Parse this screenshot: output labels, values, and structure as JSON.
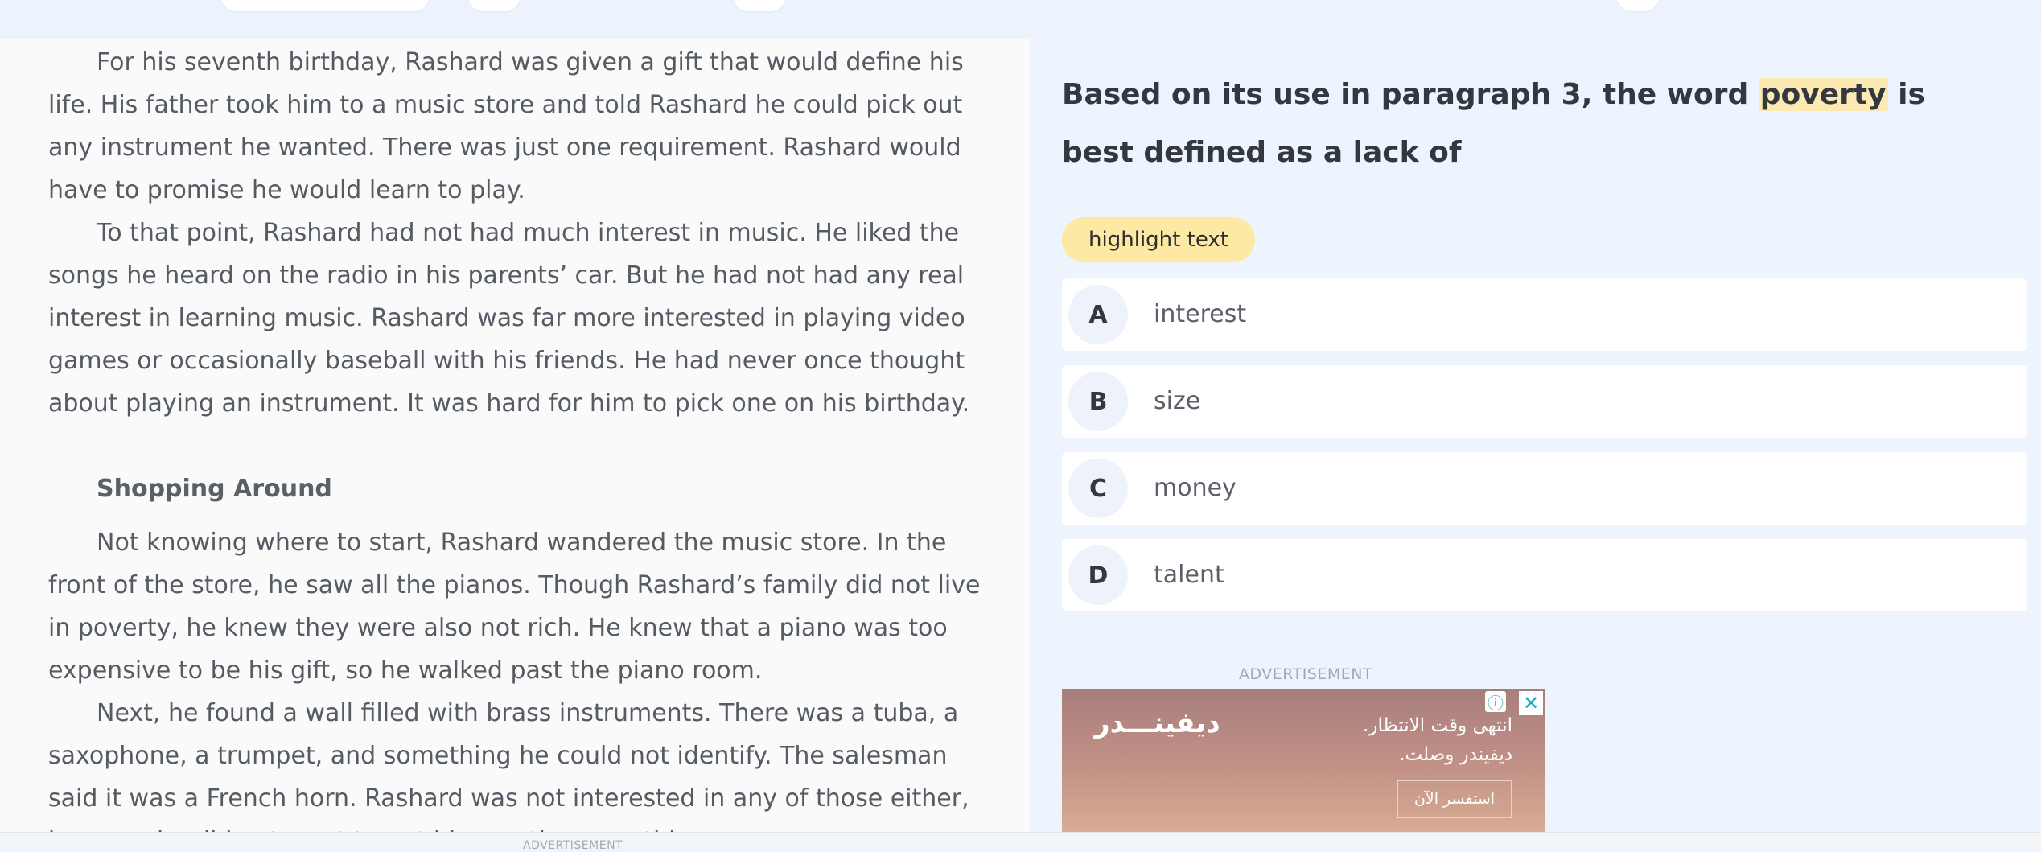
{
  "passage": {
    "paragraphs": {
      "p1": "For his seventh birthday, Rashard was given a gift that would define his life. His father took him to a music store and told Rashard he could pick out any instrument he wanted. There was just one requirement. Rashard would have to promise he would learn to play.",
      "p2": "To that point, Rashard had not had much interest in music. He liked the songs he heard on the radio in his parents’ car. But he had not had any real interest in learning music. Rashard was far more interested in playing video games or occasionally baseball with his friends. He had never once thought about playing an instrument. It was hard for him to pick one on his birthday.",
      "heading": "Shopping Around",
      "p3": "Not knowing where to start, Rashard wandered the music store. In the front of the store, he saw all the pianos. Though Rashard’s family did not live in poverty, he knew they were also not rich. He knew that a piano was too expensive to be his gift, so he walked past the piano room.",
      "p4": "Next, he found a wall filled with brass instruments. There was a tuba, a saxophone, a trumpet, and something he could not identify. The salesman said it was a French horn. Rashard was not interested in any of those either, because he did not want to put his mouth on anything."
    }
  },
  "question": {
    "before": "Based on its use in paragraph 3, the word ",
    "highlighted_word": "poverty",
    "after": " is best defined as a lack of",
    "highlight_color": "#fdeab2"
  },
  "highlight_button": {
    "label": "highlight text",
    "color": "#fde9a3"
  },
  "choices": {
    "a": {
      "letter": "A",
      "text": "interest"
    },
    "b": {
      "letter": "B",
      "text": "size"
    },
    "c": {
      "letter": "C",
      "text": "money"
    },
    "d": {
      "letter": "D",
      "text": "talent"
    }
  },
  "ad": {
    "label": "ADVERTISEMENT",
    "brand": "ديفينـــدر",
    "line1": "انتهى وقت الانتظار.",
    "line2": "ديفيندر وصلت.",
    "cta": "استفسر الآن",
    "info_icon": "info-icon",
    "close_icon": "close-icon"
  },
  "bottom_ad_label": "ADVERTISEMENT"
}
